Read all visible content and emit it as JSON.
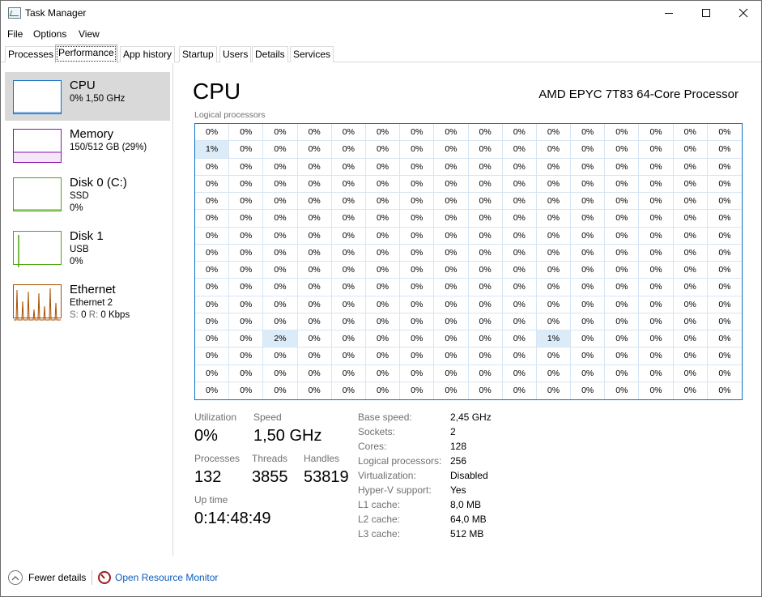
{
  "window": {
    "title": "Task Manager"
  },
  "menu": {
    "file": "File",
    "options": "Options",
    "view": "View"
  },
  "tabs": [
    {
      "label": "Processes",
      "active": false
    },
    {
      "label": "Performance",
      "active": true
    },
    {
      "label": "App history",
      "active": false
    },
    {
      "label": "Startup",
      "active": false
    },
    {
      "label": "Users",
      "active": false
    },
    {
      "label": "Details",
      "active": false
    },
    {
      "label": "Services",
      "active": false
    }
  ],
  "sidebar": {
    "items": [
      {
        "title": "CPU",
        "line1": "0%  1,50 GHz",
        "line2": "",
        "selected": true,
        "color": "#1170c9"
      },
      {
        "title": "Memory",
        "line1": "150/512 GB (29%)",
        "line2": "",
        "selected": false,
        "color": "#8b12ae"
      },
      {
        "title": "Disk 0 (C:)",
        "line1": "SSD",
        "line2": "0%",
        "selected": false,
        "color": "#4da60c"
      },
      {
        "title": "Disk 1",
        "line1": "USB",
        "line2": "0%",
        "selected": false,
        "color": "#4da60c"
      },
      {
        "title": "Ethernet",
        "line1": "Ethernet 2",
        "line2_prefix_s": "S:",
        "line2_s": "0",
        "line2_prefix_r": "R:",
        "line2_r": "0 Kbps",
        "selected": false,
        "color": "#a74f01"
      }
    ]
  },
  "main": {
    "title": "CPU",
    "processor_name": "AMD EPYC 7T83 64-Core Processor",
    "grid_label": "Logical processors",
    "grid": {
      "rows": 16,
      "cols": 16,
      "default_value": "0%",
      "exceptions": [
        {
          "row": 1,
          "col": 0,
          "value": "1%"
        },
        {
          "row": 12,
          "col": 2,
          "value": "2%"
        },
        {
          "row": 12,
          "col": 10,
          "value": "1%"
        }
      ]
    }
  },
  "stats": {
    "utilization_label": "Utilization",
    "utilization": "0%",
    "speed_label": "Speed",
    "speed": "1,50 GHz",
    "processes_label": "Processes",
    "processes": "132",
    "threads_label": "Threads",
    "threads": "3855",
    "handles_label": "Handles",
    "handles": "53819",
    "uptime_label": "Up time",
    "uptime": "0:14:48:49"
  },
  "specs": [
    {
      "label": "Base speed:",
      "value": "2,45 GHz"
    },
    {
      "label": "Sockets:",
      "value": "2"
    },
    {
      "label": "Cores:",
      "value": "128"
    },
    {
      "label": "Logical processors:",
      "value": "256"
    },
    {
      "label": "Virtualization:",
      "value": "Disabled"
    },
    {
      "label": "Hyper-V support:",
      "value": "Yes"
    },
    {
      "label": "L1 cache:",
      "value": "8,0 MB"
    },
    {
      "label": "L2 cache:",
      "value": "64,0 MB"
    },
    {
      "label": "L3 cache:",
      "value": "512 MB"
    }
  ],
  "footer": {
    "fewer_details": "Fewer details",
    "open_resource_monitor": "Open Resource Monitor"
  }
}
